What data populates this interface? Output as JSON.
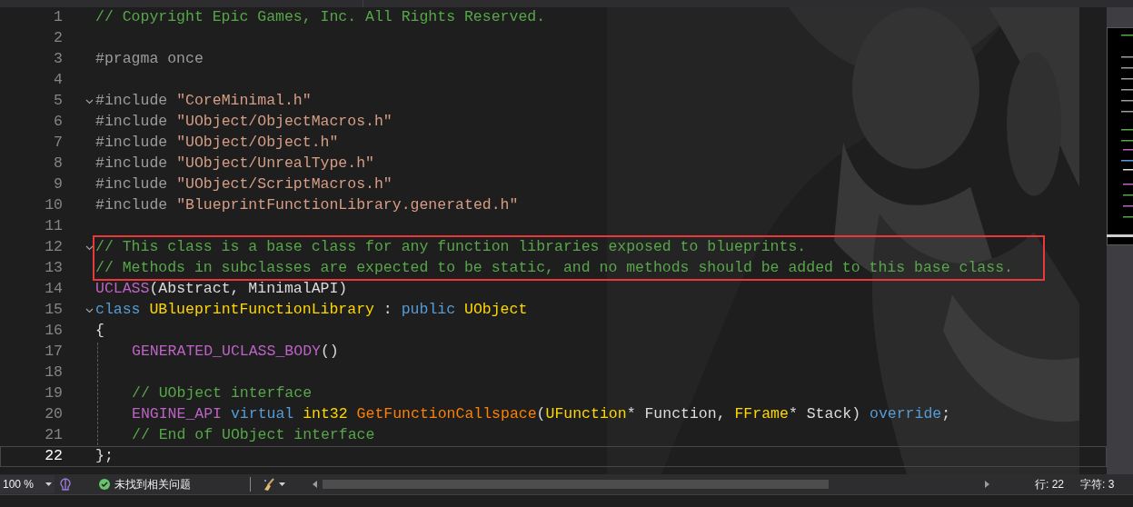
{
  "lines": [
    {
      "number": "1",
      "fold": false,
      "indented": false,
      "highlighted": false,
      "current": false,
      "tokens": [
        {
          "kind": "comment",
          "text": "// Copyright Epic Games, Inc. All Rights Reserved."
        }
      ]
    },
    {
      "number": "2",
      "fold": false,
      "indented": false,
      "highlighted": false,
      "current": false
    },
    {
      "number": "3",
      "fold": false,
      "indented": false,
      "highlighted": false,
      "current": false,
      "tokens": [
        {
          "kind": "directive",
          "text": "#pragma once"
        }
      ]
    },
    {
      "number": "4",
      "fold": false,
      "indented": false,
      "highlighted": false,
      "current": false
    },
    {
      "number": "5",
      "fold": true,
      "indented": false,
      "highlighted": false,
      "current": false,
      "tokens": [
        {
          "kind": "directive",
          "text": "#include "
        },
        {
          "kind": "string",
          "text": "\"CoreMinimal.h\""
        }
      ]
    },
    {
      "number": "6",
      "fold": false,
      "indented": false,
      "highlighted": false,
      "current": false,
      "tokens": [
        {
          "kind": "directive",
          "text": "#include "
        },
        {
          "kind": "string",
          "text": "\"UObject/ObjectMacros.h\""
        }
      ]
    },
    {
      "number": "7",
      "fold": false,
      "indented": false,
      "highlighted": false,
      "current": false,
      "tokens": [
        {
          "kind": "directive",
          "text": "#include "
        },
        {
          "kind": "string",
          "text": "\"UObject/Object.h\""
        }
      ]
    },
    {
      "number": "8",
      "fold": false,
      "indented": false,
      "highlighted": false,
      "current": false,
      "tokens": [
        {
          "kind": "directive",
          "text": "#include "
        },
        {
          "kind": "string",
          "text": "\"UObject/UnrealType.h\""
        }
      ]
    },
    {
      "number": "9",
      "fold": false,
      "indented": false,
      "highlighted": false,
      "current": false,
      "tokens": [
        {
          "kind": "directive",
          "text": "#include "
        },
        {
          "kind": "string",
          "text": "\"UObject/ScriptMacros.h\""
        }
      ]
    },
    {
      "number": "10",
      "fold": false,
      "indented": false,
      "highlighted": false,
      "current": false,
      "tokens": [
        {
          "kind": "directive",
          "text": "#include "
        },
        {
          "kind": "string",
          "text": "\"BlueprintFunctionLibrary.generated.h\""
        }
      ]
    },
    {
      "number": "11",
      "fold": false,
      "indented": false,
      "highlighted": false,
      "current": false
    },
    {
      "number": "12",
      "fold": true,
      "indented": false,
      "highlighted": true,
      "current": false,
      "tokens": [
        {
          "kind": "comment",
          "text": "// This class is a base class for any function libraries exposed to blueprints."
        }
      ]
    },
    {
      "number": "13",
      "fold": false,
      "indented": false,
      "highlighted": true,
      "current": false,
      "tokens": [
        {
          "kind": "comment",
          "text": "// Methods in subclasses are expected to be static, and no methods should be added to this base class."
        }
      ]
    },
    {
      "number": "14",
      "fold": false,
      "indented": false,
      "highlighted": false,
      "current": false,
      "tokens": [
        {
          "kind": "macro",
          "text": "UCLASS"
        },
        {
          "kind": "plain",
          "text": "(Abstract, MinimalAPI)"
        }
      ]
    },
    {
      "number": "15",
      "fold": true,
      "indented": false,
      "highlighted": false,
      "current": false,
      "tokens": [
        {
          "kind": "keyword",
          "text": "class"
        },
        {
          "kind": "type",
          "text": " UBlueprintFunctionLibrary"
        },
        {
          "kind": "plain",
          "text": " : "
        },
        {
          "kind": "keyword",
          "text": "public"
        },
        {
          "kind": "type",
          "text": " UObject"
        }
      ]
    },
    {
      "number": "16",
      "fold": false,
      "indented": false,
      "highlighted": false,
      "current": false,
      "tokens": [
        {
          "kind": "plain",
          "text": "{"
        }
      ]
    },
    {
      "number": "17",
      "fold": false,
      "indented": true,
      "highlighted": false,
      "current": false,
      "tokens": [
        {
          "kind": "macro",
          "text": "GENERATED_UCLASS_BODY"
        },
        {
          "kind": "plain",
          "text": "()"
        }
      ]
    },
    {
      "number": "18",
      "fold": false,
      "indented": true,
      "highlighted": false,
      "current": false
    },
    {
      "number": "19",
      "fold": false,
      "indented": true,
      "highlighted": false,
      "current": false,
      "tokens": [
        {
          "kind": "comment",
          "text": "// UObject interface"
        }
      ]
    },
    {
      "number": "20",
      "fold": false,
      "indented": true,
      "highlighted": false,
      "current": false,
      "tokens": [
        {
          "kind": "macro",
          "text": "ENGINE_API"
        },
        {
          "kind": "keyword",
          "text": " virtual"
        },
        {
          "kind": "type",
          "text": " int32"
        },
        {
          "kind": "function",
          "text": " GetFunctionCallspace"
        },
        {
          "kind": "plain",
          "text": "("
        },
        {
          "kind": "type",
          "text": "UFunction"
        },
        {
          "kind": "plain",
          "text": "* Function, "
        },
        {
          "kind": "type",
          "text": "FFrame"
        },
        {
          "kind": "plain",
          "text": "* Stack) "
        },
        {
          "kind": "keyword",
          "text": "override"
        },
        {
          "kind": "plain",
          "text": ";"
        }
      ]
    },
    {
      "number": "21",
      "fold": false,
      "indented": true,
      "highlighted": false,
      "current": false,
      "tokens": [
        {
          "kind": "comment",
          "text": "// End of UObject interface"
        }
      ]
    },
    {
      "number": "22",
      "fold": false,
      "indented": false,
      "highlighted": false,
      "current": true,
      "tokens": [
        {
          "kind": "plain",
          "text": "};"
        }
      ]
    }
  ],
  "status_bar": {
    "zoom": "100 %",
    "issues": "未找到相关问题",
    "line": "行: 22",
    "column": "字符: 3"
  }
}
